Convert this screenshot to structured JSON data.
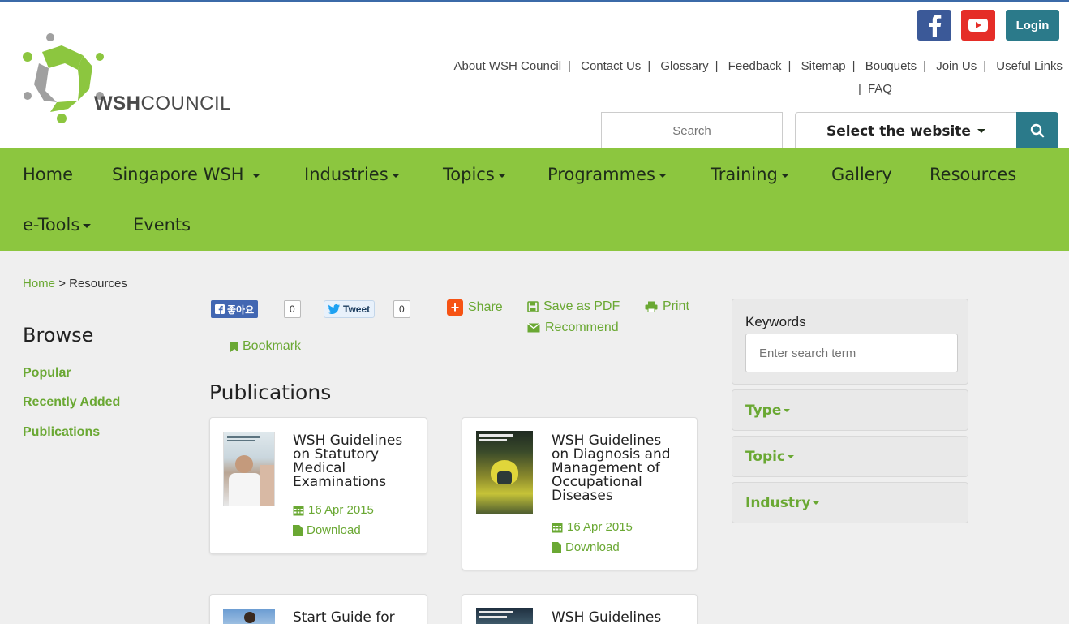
{
  "header": {
    "logo_text_bold": "WSH",
    "logo_text_rest": "COUNCIL",
    "login_label": "Login",
    "top_links_row1": [
      "About WSH Council",
      "Contact Us",
      "Glossary",
      "Feedback",
      "Sitemap",
      "Bouquets",
      "Join Us",
      "Useful Links"
    ],
    "top_links_row2": [
      "FAQ"
    ],
    "search_placeholder": "Search",
    "select_site_label": "Select the website"
  },
  "nav": {
    "items": [
      "Home",
      "Singapore WSH",
      "Industries",
      "Topics",
      "Programmes",
      "Training",
      "Gallery",
      "Resources",
      "e-Tools",
      "Events"
    ]
  },
  "breadcrumb": {
    "home": "Home",
    "sep": ">",
    "current": "Resources"
  },
  "browse": {
    "title": "Browse",
    "links": [
      "Popular",
      "Recently Added",
      "Publications"
    ]
  },
  "share": {
    "fb_like_label": "좋아요",
    "fb_count": "0",
    "tweet_label": "Tweet",
    "tweet_count": "0",
    "share_label": "Share",
    "save_pdf_label": "Save as PDF",
    "print_label": "Print",
    "recommend_label": "Recommend",
    "bookmark_label": "Bookmark"
  },
  "publications": {
    "title": "Publications",
    "items": [
      {
        "title_lines": [
          "WSH Guidelines",
          "on Statutory",
          "Medical",
          "Examinations"
        ],
        "date": "16 Apr 2015",
        "download": "Download"
      },
      {
        "title_lines": [
          "WSH Guidelines",
          "on Diagnosis and",
          "Management of",
          "Occupational",
          "Diseases"
        ],
        "date": "16 Apr 2015",
        "download": "Download"
      },
      {
        "title_lines": [
          "Start Guide for"
        ]
      },
      {
        "title_lines": [
          "WSH Guidelines"
        ]
      }
    ]
  },
  "filters": {
    "keywords_label": "Keywords",
    "keywords_placeholder": "Enter search term",
    "type_label": "Type",
    "topic_label": "Topic",
    "industry_label": "Industry"
  },
  "colors": {
    "nav_green": "#8cc63f",
    "link_green": "#6aa833",
    "teal": "#2b7a8a",
    "facebook": "#3b5998",
    "youtube": "#e52d27"
  }
}
